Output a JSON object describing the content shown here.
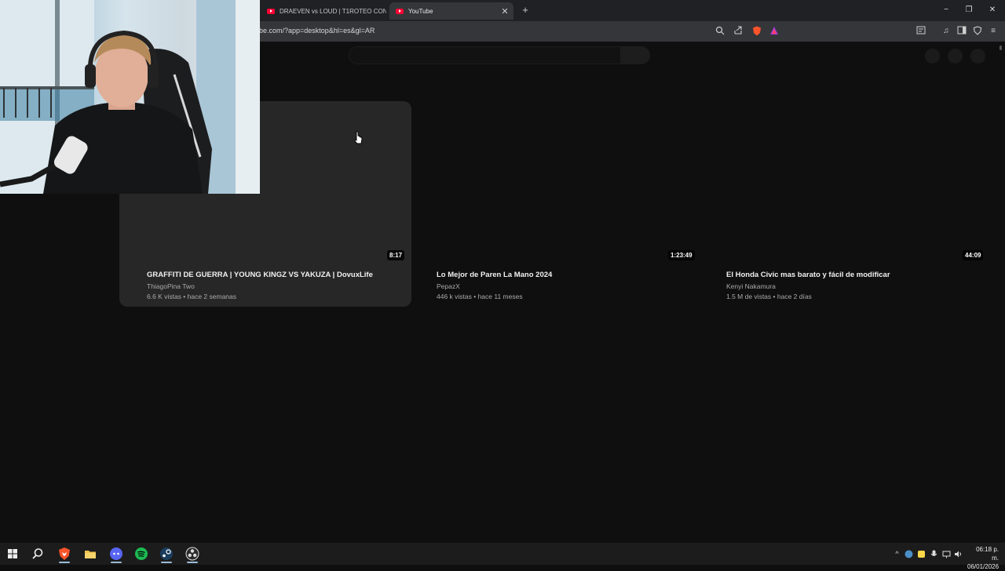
{
  "browser": {
    "tabs": [
      {
        "title": "DRAEVEN vs LOUD | T1ROTEO CON",
        "active": false
      },
      {
        "title": "YouTube",
        "active": true
      }
    ],
    "new_tab": "+",
    "url": "be.com/?app=desktop&hl=es&gl=AR",
    "window_controls": {
      "minimize": "−",
      "restore": "❐",
      "close": "✕"
    }
  },
  "videos": [
    {
      "title": "GRAFFITI DE GUERRA | YOUNG KINGZ VS YAKUZA | DovuxLife",
      "channel": "ThiagoPina Two",
      "meta": "6.6 K vistas • hace 2 semanas",
      "duration": "8:17"
    },
    {
      "title": "Lo Mejor de Paren La Mano 2024",
      "channel": "PepazX",
      "meta": "446 k vistas • hace 11 meses",
      "duration": "1:23:49"
    },
    {
      "title": "El Honda Civic mas barato y fácil de modificar",
      "channel": "Kenyi Nakamura",
      "meta": "1.5 M de vistas • hace 2 días",
      "duration": "44:09"
    }
  ],
  "taskbar": {
    "clock_time": "06:18 p. m.",
    "clock_date": "06/01/2026"
  },
  "colors": {
    "background": "#0f0f0f",
    "card_hover": "#272727",
    "youtube_red": "#ff0033"
  }
}
